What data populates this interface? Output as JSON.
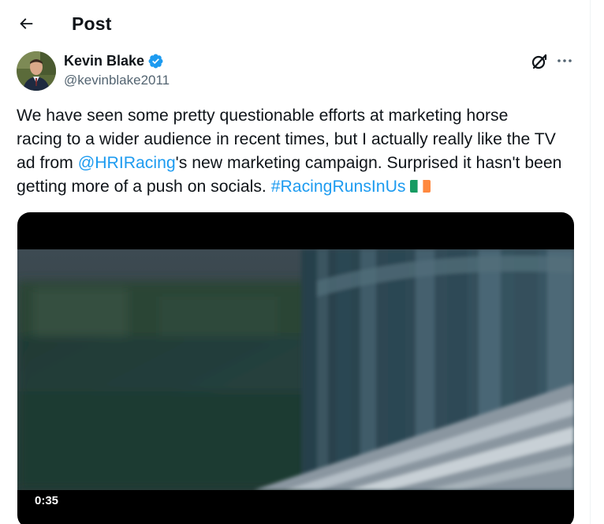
{
  "header": {
    "title": "Post",
    "back_icon": "arrow-left-icon"
  },
  "author": {
    "name": "Kevin Blake",
    "handle": "@kevinblake2011",
    "verified": true,
    "verified_color": "#1d9bf0"
  },
  "actions": {
    "grok_icon": "grok-icon",
    "more_icon": "more-horizontal-icon"
  },
  "tweet": {
    "line1": "We have seen some pretty questionable efforts at marketing horse",
    "line2": "racing to a wider audience in recent times, but I actually really like the TV",
    "line3_pre": "ad from ",
    "mention": "@HRIRacing",
    "line3_post": "'s new marketing campaign. Surprised it hasn't been",
    "line4_pre": "getting more of a push on socials. ",
    "hashtag": "#RacingRunsInUs",
    "flag_icon": "ireland-flag-icon"
  },
  "media": {
    "type": "video",
    "duration": "0:35"
  },
  "colors": {
    "text": "#0f1419",
    "secondary": "#536471",
    "link": "#1d9bf0"
  }
}
